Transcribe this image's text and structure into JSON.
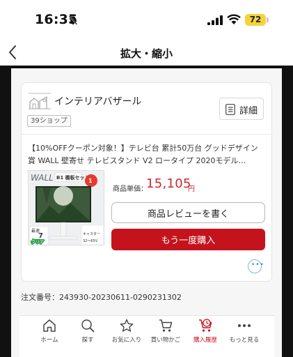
{
  "status_bar": {
    "time": "16:35",
    "battery": "72",
    "battery_color": "#f6d33a"
  },
  "nav": {
    "title": "拡大・縮小",
    "back_icon": "chevron-left-icon"
  },
  "shop": {
    "name": "インテリアバザール",
    "tag": "39ショップ",
    "detail_label": "詳細",
    "detail_icon": "list-icon"
  },
  "product": {
    "title": "【10%OFFクーポン対象！】テレビ台 累計50万台 グッドデザイン賞 WALL 壁寄せ テレビスタンド V2 ロータイプ 2020モデル…",
    "price_label": "商品単価：",
    "price": "15,105",
    "price_unit": "円",
    "image": {
      "brand": "WALL",
      "badge": "B1 棚板セット",
      "tag1": "最速",
      "tag2": "7",
      "tag3": "クリア",
      "caster": "キャスター",
      "size": "32～65V"
    }
  },
  "actions": {
    "review_label": "商品レビューを書く",
    "rebuy_label": "もう一度購入",
    "more_icon": "ellipsis-icon"
  },
  "order": {
    "label": "注文番号：",
    "value": "243930-20230611-0290231302"
  },
  "tabs": [
    {
      "label": "ホーム",
      "icon": "home-icon"
    },
    {
      "label": "探す",
      "icon": "search-icon"
    },
    {
      "label": "お気に入り",
      "icon": "star-icon"
    },
    {
      "label": "買い物かご",
      "icon": "cart-icon"
    },
    {
      "label": "購入履歴",
      "icon": "history-icon",
      "active": true
    },
    {
      "label": "もっと見る",
      "icon": "more-icon"
    }
  ],
  "colors": {
    "accent": "#c4131d",
    "price": "#d1262f"
  }
}
